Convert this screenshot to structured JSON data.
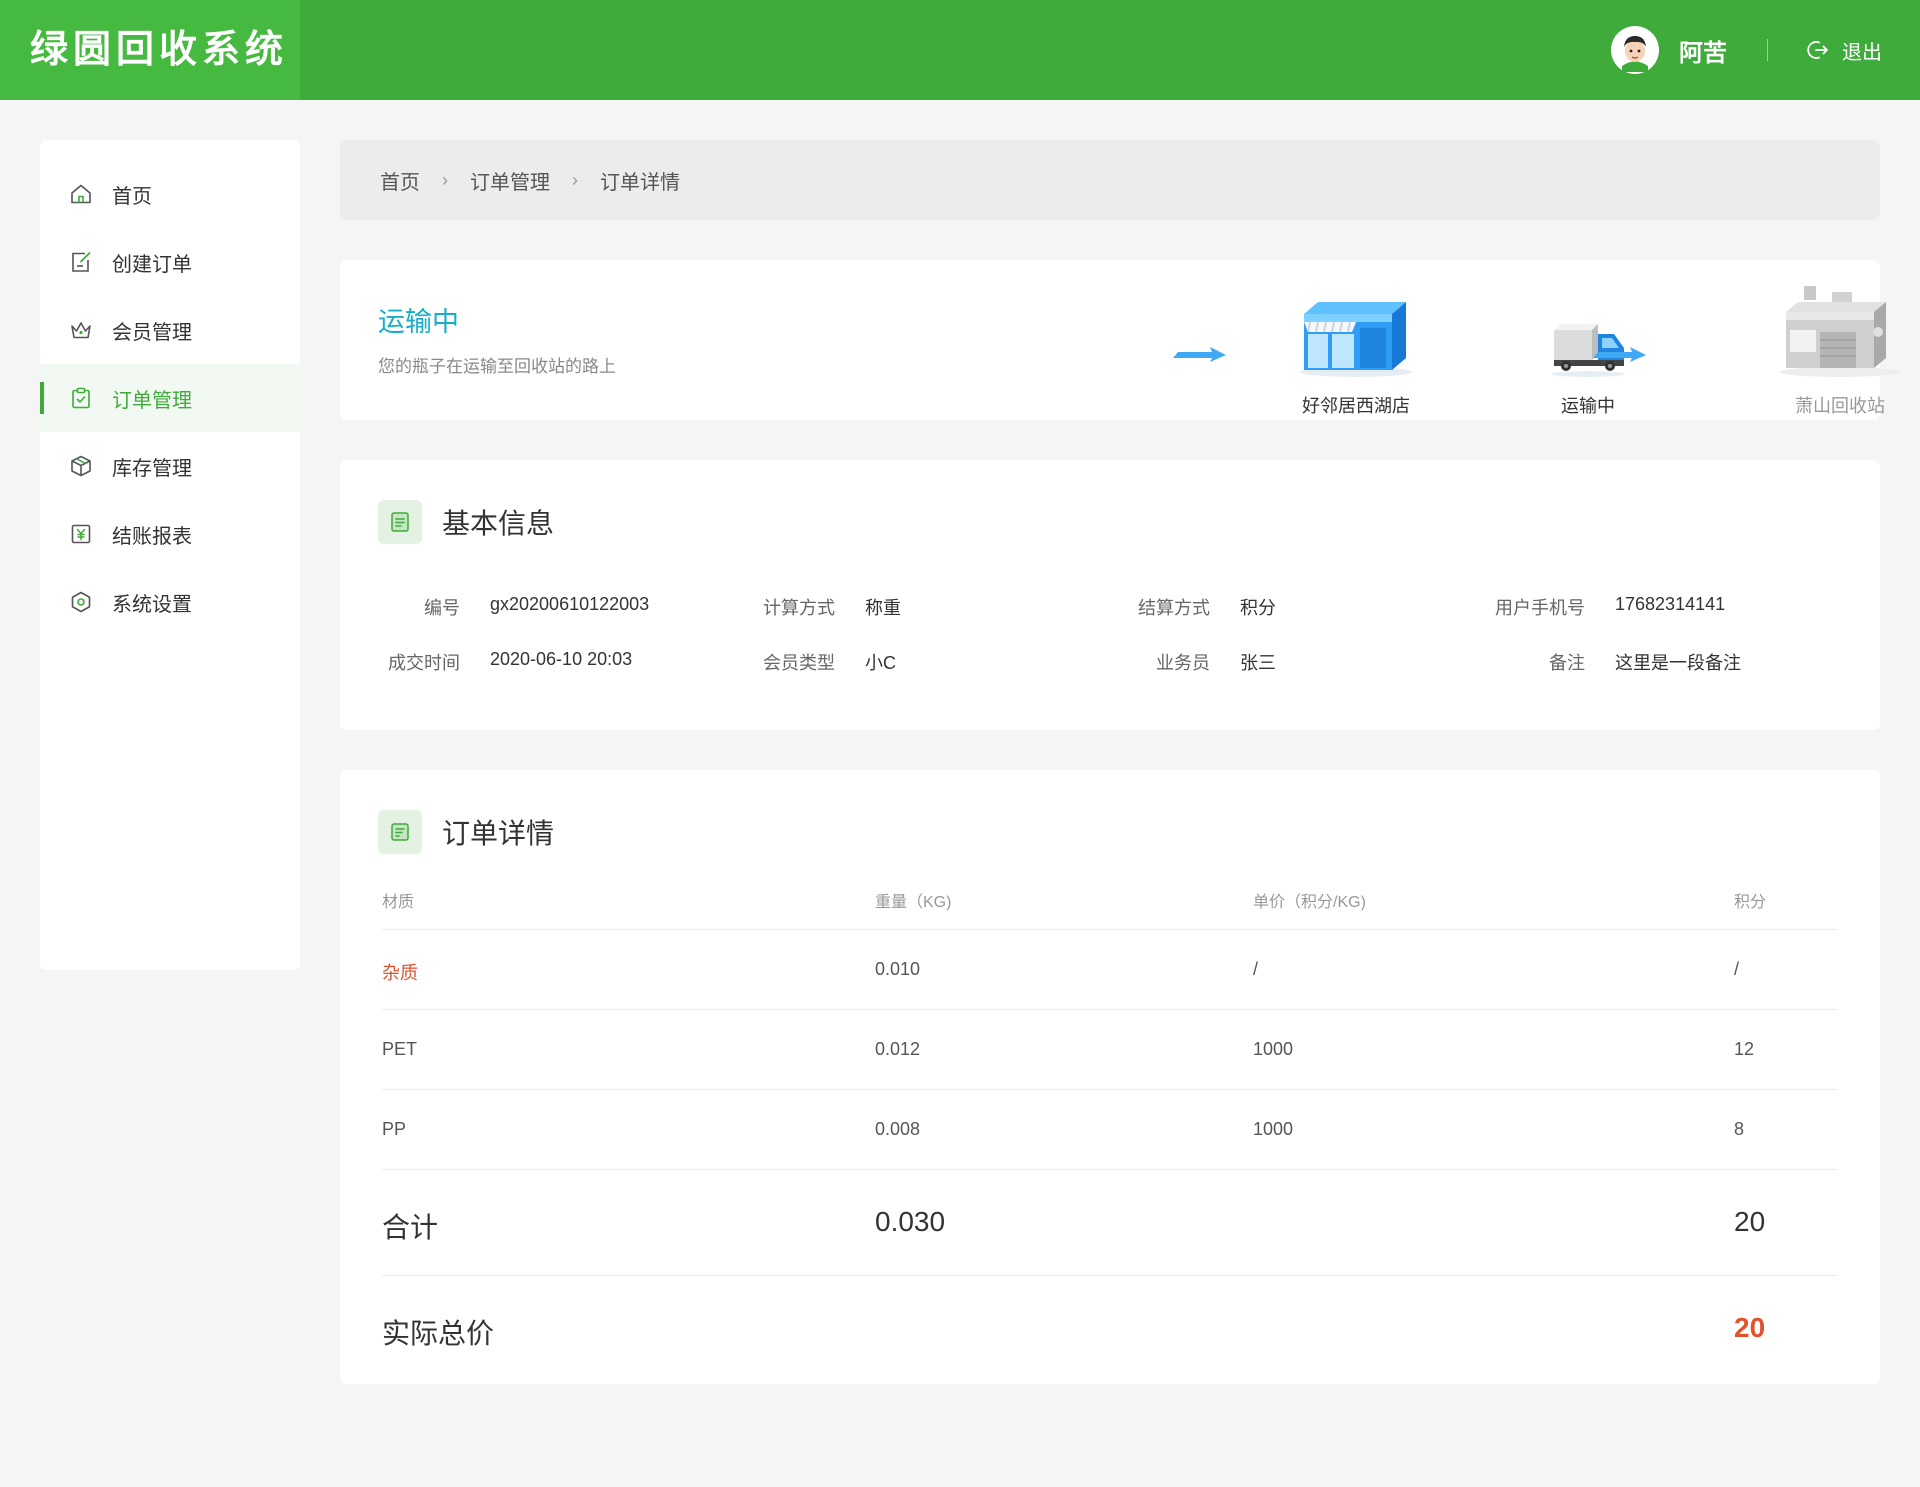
{
  "header": {
    "app_title": "绿圆回收系统",
    "username": "阿苦",
    "logout_label": "退出"
  },
  "sidebar": {
    "items": [
      {
        "label": "首页",
        "icon": "home-icon",
        "active": false
      },
      {
        "label": "创建订单",
        "icon": "edit-icon",
        "active": false
      },
      {
        "label": "会员管理",
        "icon": "crown-icon",
        "active": false
      },
      {
        "label": "订单管理",
        "icon": "clipboard-icon",
        "active": true
      },
      {
        "label": "库存管理",
        "icon": "box-icon",
        "active": false
      },
      {
        "label": "结账报表",
        "icon": "yuan-icon",
        "active": false
      },
      {
        "label": "系统设置",
        "icon": "settings-icon",
        "active": false
      }
    ]
  },
  "breadcrumb": {
    "items": [
      "首页",
      "订单管理",
      "订单详情"
    ]
  },
  "status": {
    "title": "运输中",
    "subtitle": "您的瓶子在运输至回收站的路上",
    "stations": [
      "好邻居西湖店",
      "运输中",
      "萧山回收站"
    ]
  },
  "basic_info": {
    "title": "基本信息",
    "fields": [
      {
        "key": "编号",
        "value": "gx20200610122003"
      },
      {
        "key": "计算方式",
        "value": "称重"
      },
      {
        "key": "结算方式",
        "value": "积分"
      },
      {
        "key": "用户手机号",
        "value": "17682314141"
      },
      {
        "key": "成交时间",
        "value": "2020-06-10 20:03"
      },
      {
        "key": "会员类型",
        "value": "小C"
      },
      {
        "key": "业务员",
        "value": "张三"
      },
      {
        "key": "备注",
        "value": "这里是一段备注"
      }
    ]
  },
  "order_detail": {
    "title": "订单详情",
    "columns": [
      "材质",
      "重量（KG)",
      "单价（积分/KG)",
      "积分"
    ],
    "rows": [
      [
        "杂质",
        "0.010",
        "/",
        "/"
      ],
      [
        "PET",
        "0.012",
        "1000",
        "12"
      ],
      [
        "PP",
        "0.008",
        "1000",
        "8"
      ]
    ],
    "total": {
      "label": "合计",
      "weight": "0.030",
      "points": "20"
    },
    "actual": {
      "label": "实际总价",
      "value": "20"
    }
  },
  "colors": {
    "brand": "#3fab3b",
    "status_teal": "#1aaec4",
    "alert_red": "#e0532d"
  }
}
